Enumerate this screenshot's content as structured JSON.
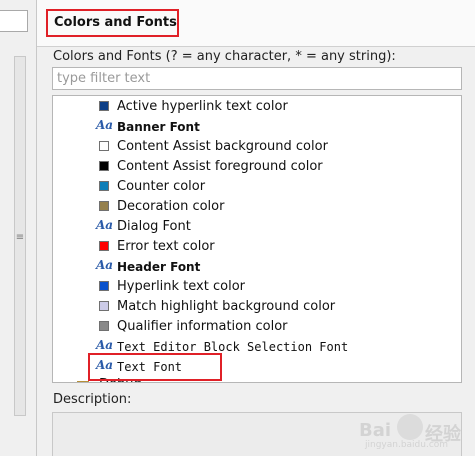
{
  "title": "Colors and Fonts",
  "intro": "Colors and Fonts (? = any character, * = any string):",
  "filter": {
    "placeholder": "type filter text"
  },
  "left_panel": {
    "grip": "≡"
  },
  "list": {
    "items": [
      {
        "label": "Active hyperlink text color",
        "kind": "color",
        "color": "#0c3e86"
      },
      {
        "label": "Banner Font",
        "kind": "font",
        "bold": true
      },
      {
        "label": "Content Assist background color",
        "kind": "color",
        "color": "#ffffff"
      },
      {
        "label": "Content Assist foreground color",
        "kind": "color",
        "color": "#000000"
      },
      {
        "label": "Counter color",
        "kind": "color",
        "color": "#0f7fb8"
      },
      {
        "label": "Decoration color",
        "kind": "color",
        "color": "#95804c"
      },
      {
        "label": "Dialog Font",
        "kind": "font"
      },
      {
        "label": "Error text color",
        "kind": "color",
        "color": "#ff0000"
      },
      {
        "label": "Header Font",
        "kind": "font",
        "bold": true
      },
      {
        "label": "Hyperlink text color",
        "kind": "color",
        "color": "#0a52cc"
      },
      {
        "label": "Match highlight background color",
        "kind": "color",
        "color": "#cccbe8"
      },
      {
        "label": "Qualifier information color",
        "kind": "color",
        "color": "#8a8a8a"
      },
      {
        "label": "Text Editor Block Selection Font",
        "kind": "font",
        "mono": true
      },
      {
        "label": "Text Font",
        "kind": "font",
        "mono": true
      }
    ],
    "partial": "Debug"
  },
  "font_glyph": "Aa",
  "description_label": "Description:",
  "watermark": {
    "part1": "Bai",
    "part2": "经验",
    "url": "jingyan.baidu.com"
  }
}
